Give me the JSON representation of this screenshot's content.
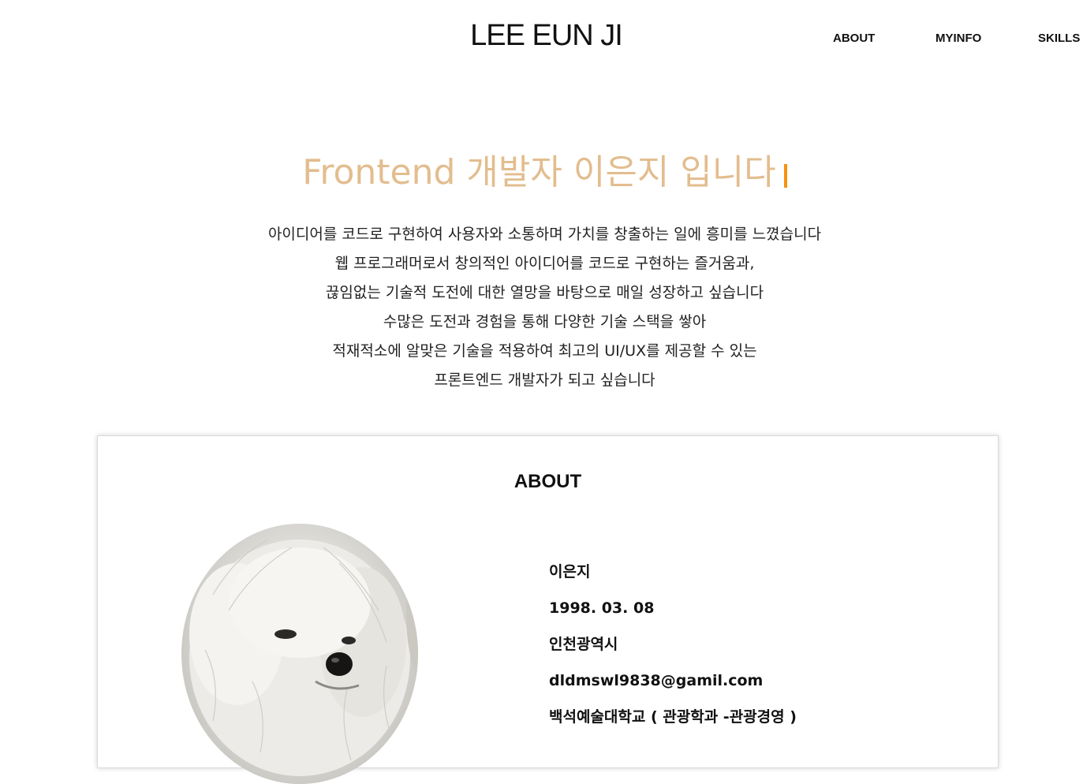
{
  "header": {
    "logo": "LEE EUN JI",
    "nav": [
      "ABOUT",
      "MYINFO",
      "SKILLS"
    ]
  },
  "hero": {
    "title": "Frontend 개발자 이은지 입니다",
    "intro_lines": [
      "아이디어를 코드로 구현하여 사용자와 소통하며 가치를 창출하는 일에 흥미를 느꼈습니다",
      "웹 프로그래머로서 창의적인 아이디어를 코드로 구현하는 즐거움과,",
      "끊임없는 기술적 도전에 대한 열망을 바탕으로 매일 성장하고 싶습니다",
      "수많은 도전과 경험을 통해 다양한 기술 스택을 쌓아",
      "적재적소에 알맞은 기술을 적용하여 최고의 UI/UX를 제공할 수 있는",
      "프론트엔드 개발자가 되고 싶습니다"
    ]
  },
  "about": {
    "title": "ABOUT",
    "info": [
      "이은지",
      "1998. 03. 08",
      "인천광역시",
      "dldmswl9838@gamil.com",
      "백석예술대학교 ( 관광학과 -관광경영 )"
    ]
  },
  "colors": {
    "title_accent": "#e3bd8f",
    "caret": "#f5930f"
  }
}
